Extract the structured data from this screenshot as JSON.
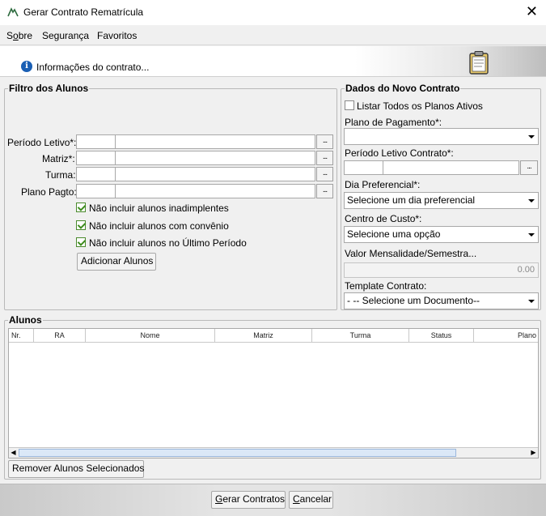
{
  "window": {
    "title": "Gerar Contrato Rematrícula",
    "close": "✕"
  },
  "menu": {
    "sobre_pre": "S",
    "sobre_ul": "o",
    "sobre_post": "bre",
    "seguranca": "Segurança",
    "favoritos": "Favoritos"
  },
  "info": {
    "icon": "i",
    "text": "Informações do contrato..."
  },
  "filtro": {
    "legend": "Filtro dos Alunos",
    "periodo_label": "Período Letivo*:",
    "matriz_label": "Matriz*:",
    "turma_label": "Turma:",
    "plano_label": "Plano Pagto:",
    "lookup_btn": "...",
    "chk_inadimplentes": "Não incluir alunos inadimplentes",
    "chk_convenio": "Não incluir alunos com convênio",
    "chk_ultimo": "Não incluir alunos no Último Período",
    "adicionar_btn": "Adicionar Alunos"
  },
  "novo_contrato": {
    "legend": "Dados do Novo Contrato",
    "listar_todos": "Listar Todos os Planos Ativos",
    "plano_label": "Plano de Pagamento*:",
    "plano_value": "",
    "periodo_label": "Período Letivo Contrato*:",
    "dia_label": "Dia Preferencial*:",
    "dia_value": "Selecione um dia preferencial",
    "centro_label": "Centro de Custo*:",
    "centro_value": "Selecione uma opção",
    "valor_label": "Valor Mensalidade/Semestra...",
    "valor_value": "0.00",
    "template_label": "Template Contrato:",
    "template_value": "- -- Selecione um Documento--"
  },
  "alunos": {
    "legend": "Alunos",
    "columns": [
      "Nr.",
      "RA",
      "Nome",
      "Matriz",
      "Turma",
      "Status",
      "Plano"
    ],
    "remover_btn": "Remover Alunos Selecionados"
  },
  "footer": {
    "gerar_ul": "G",
    "gerar_post": "erar Contratos",
    "cancelar_ul": "C",
    "cancelar_post": "ancelar"
  },
  "colors": {
    "accent": "#1a5fb4",
    "check": "#3f8d1f",
    "scroll_thumb": "#dbe8f7"
  }
}
